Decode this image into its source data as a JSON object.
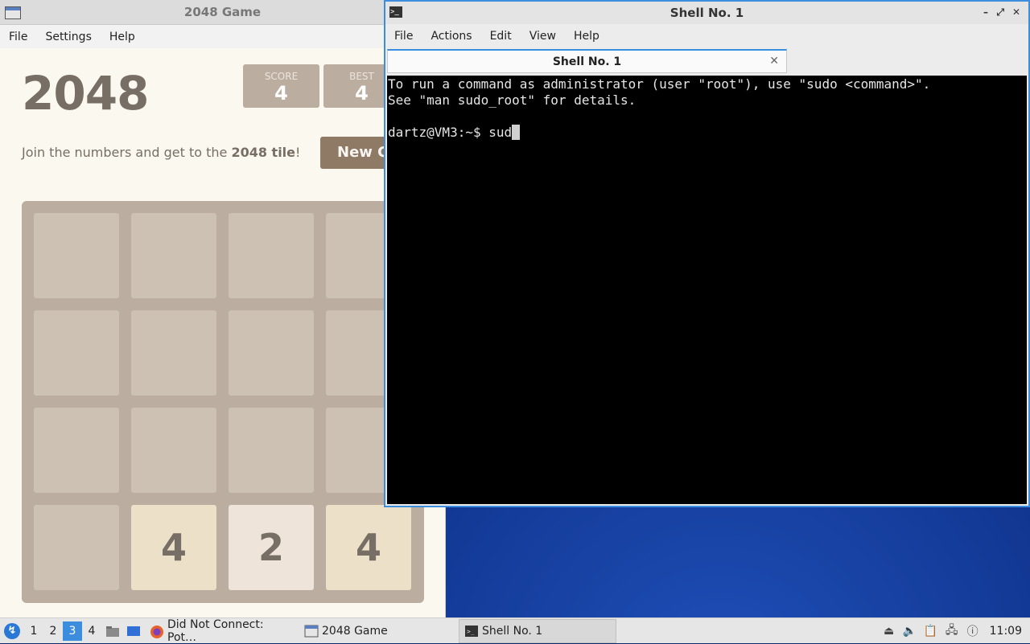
{
  "game_window": {
    "title": "2048 Game",
    "menu": [
      "File",
      "Settings",
      "Help"
    ],
    "heading": "2048",
    "score_label": "SCORE",
    "score_value": "4",
    "best_label": "BEST",
    "best_value": "4",
    "intro_text": "Join the numbers and get to the ",
    "intro_bold": "2048 tile",
    "intro_end": "!",
    "new_game_label": "New Game",
    "tiles": [
      "",
      "",
      "",
      "",
      "",
      "",
      "",
      "",
      "",
      "",
      "",
      "",
      "",
      "4",
      "2",
      "4"
    ]
  },
  "terminal": {
    "title": "Shell No. 1",
    "menu": [
      "File",
      "Actions",
      "Edit",
      "View",
      "Help"
    ],
    "tab_label": "Shell No. 1",
    "lines": [
      "To run a command as administrator (user \"root\"), use \"sudo <command>\".",
      "See \"man sudo_root\" for details.",
      ""
    ],
    "prompt": "dartz@VM3:~$ ",
    "command": "sud"
  },
  "taskbar": {
    "workspaces": [
      "1",
      "2",
      "3",
      "4"
    ],
    "active_workspace": "3",
    "tasks": [
      {
        "label": "Did Not Connect: Pot…",
        "icon": "firefox-icon"
      },
      {
        "label": "2048 Game",
        "icon": "window-icon"
      },
      {
        "label": "Shell No. 1",
        "icon": "terminal-icon"
      }
    ],
    "clock": "11:09"
  }
}
